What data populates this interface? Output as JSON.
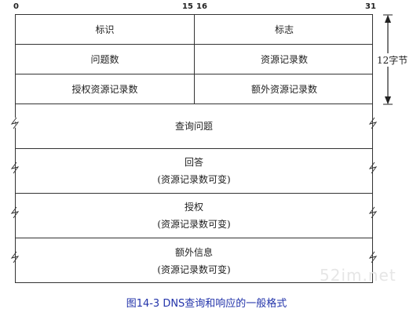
{
  "bit_labels": {
    "start": "0",
    "mid_a": "15",
    "mid_b": "16",
    "end": "31"
  },
  "header": {
    "id": "标识",
    "flags": "标志",
    "questions": "问题数",
    "answer_rrs": "资源记录数",
    "authority_rrs": "授权资源记录数",
    "additional_rrs": "额外资源记录数"
  },
  "size_label": "12字节",
  "sections": [
    {
      "title": "查询问题",
      "sub": ""
    },
    {
      "title": "回答",
      "sub": "(资源记录数可变)"
    },
    {
      "title": "授权",
      "sub": "(资源记录数可变)"
    },
    {
      "title": "额外信息",
      "sub": "(资源记录数可变)"
    }
  ],
  "watermark": "52im.net",
  "caption": "图14-3 DNS查询和响应的一般格式"
}
